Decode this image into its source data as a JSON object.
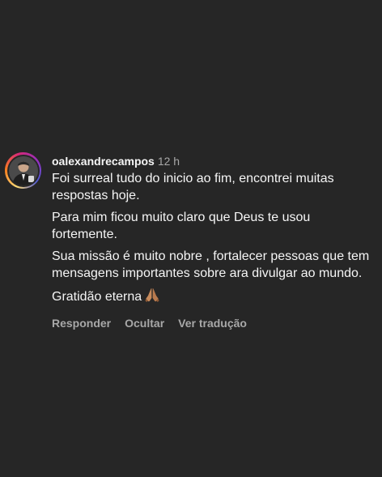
{
  "comment": {
    "username": "oalexandrecampos",
    "time": "12 h",
    "paragraphs": [
      "Foi surreal tudo do inicio ao fim, encontrei muitas respostas hoje.",
      "Para mim ficou muito claro que Deus te usou fortemente.",
      "Sua missão é muito nobre , fortalecer pessoas que tem mensagens importantes sobre ara divulgar ao mundo.",
      "Gratidão eterna"
    ],
    "emoji_icon": "folded-hands-icon",
    "actions": {
      "reply": "Responder",
      "hide": "Ocultar",
      "translate": "Ver tradução"
    }
  },
  "colors": {
    "background": "#262626",
    "text": "#f5f5f5",
    "secondary": "#a8a8a8"
  }
}
